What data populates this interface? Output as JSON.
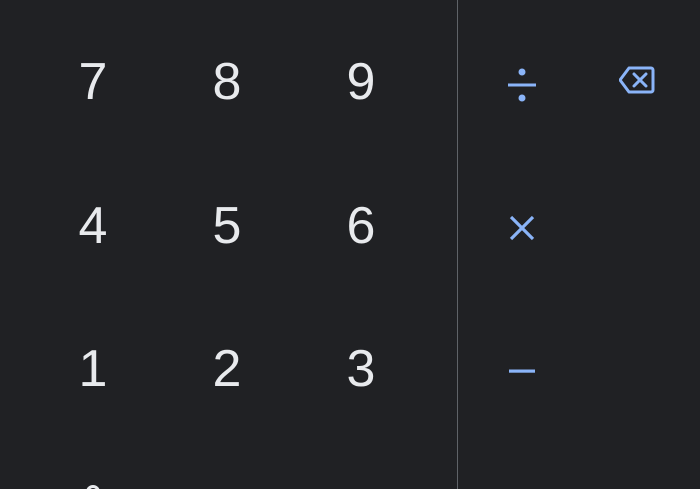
{
  "keypad": {
    "digits": {
      "seven": "7",
      "eight": "8",
      "nine": "9",
      "four": "4",
      "five": "5",
      "six": "6",
      "one": "1",
      "two": "2",
      "three": "3"
    }
  },
  "operators": {
    "divide": {
      "icon": "divide-icon"
    },
    "multiply": {
      "icon": "multiply-icon"
    },
    "subtract": {
      "icon": "minus-icon"
    },
    "backspace": {
      "icon": "backspace-icon"
    }
  },
  "colors": {
    "background": "#202124",
    "digit_text": "#e8eaed",
    "operator_accent": "#8ab4f8",
    "divider": "#5f6368"
  }
}
